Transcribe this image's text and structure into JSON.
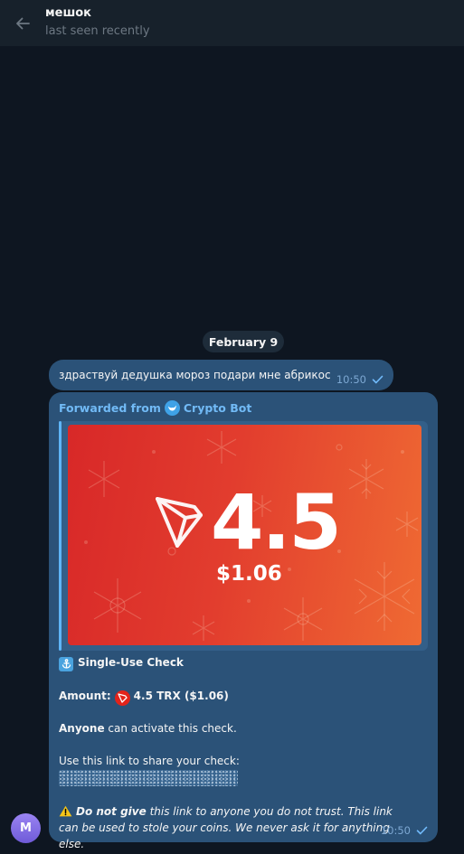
{
  "header": {
    "title": "мешок",
    "status": "last seen recently"
  },
  "date_divider": "February 9",
  "messages": [
    {
      "text": "здраствуй дедушка мороз подари мне абрикос",
      "time": "10:50",
      "status_icon": "single-check-icon"
    },
    {
      "forwarded_prefix": "Forwarded from",
      "forwarded_name": "Crypto Bot",
      "forwarded_icon": "crypto-bot-icon",
      "image": {
        "amount": "4.5",
        "usd": "$1.06",
        "logo": "tron-logo"
      },
      "check_title": "Single-Use Check",
      "amount_label": "Amount:",
      "amount_value": "4.5 TRX ($1.06)",
      "anyone_bold": "Anyone",
      "anyone_rest": "can activate this check.",
      "share_line": "Use this link to share your check:",
      "warning_bold": "Do not give",
      "warning_rest": "this link to anyone you do not trust. This link can be used to stole your coins. We never ask it for anything else.",
      "time": "10:50",
      "status_icon": "single-check-icon"
    }
  ],
  "avatar_letter": "M",
  "colors": {
    "background": "#0e1621",
    "header": "#17212b",
    "bubble": "#2b5278",
    "accent": "#71baf6",
    "check_image_start": "#d82828",
    "check_image_end": "#ef6a33"
  }
}
